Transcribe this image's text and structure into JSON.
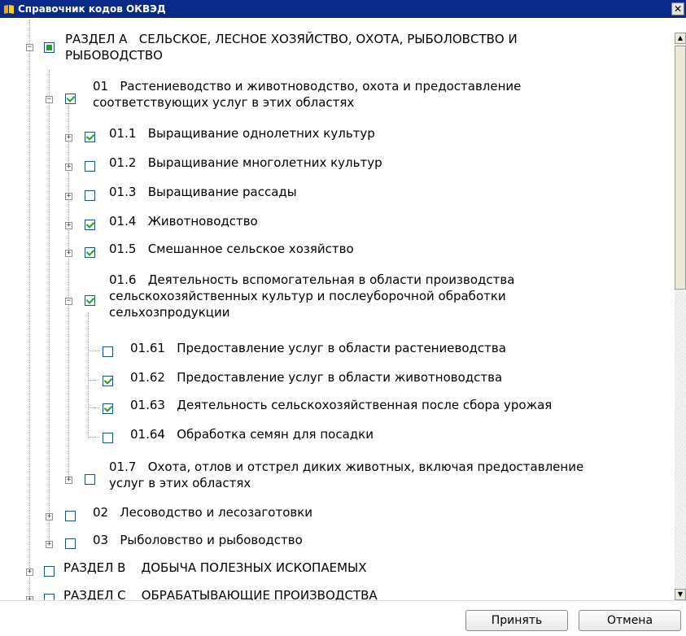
{
  "window": {
    "title": "Справочник кодов ОКВЭД",
    "close_glyph": "✕"
  },
  "tree": {
    "nodes": [
      {
        "code": "РАЗДЕЛ А",
        "text": "СЕЛЬСКОЕ, ЛЕСНОЕ ХОЗЯЙСТВО, ОХОТА, РЫБОЛОВСТВО И РЫБОВОДСТВО",
        "state": "partial",
        "expanded": true
      },
      {
        "code": "01",
        "text": "Растениеводство и животноводство, охота и предоставление соответствующих услуг в этих областях",
        "state": "checked",
        "expanded": true
      },
      {
        "code": "01.1",
        "text": "Выращивание однолетних культур",
        "state": "checked",
        "expanded": false
      },
      {
        "code": "01.2",
        "text": "Выращивание многолетних культур",
        "state": "unchecked",
        "expanded": false
      },
      {
        "code": "01.3",
        "text": "Выращивание рассады",
        "state": "unchecked",
        "expanded": false
      },
      {
        "code": "01.4",
        "text": "Животноводство",
        "state": "checked",
        "expanded": false
      },
      {
        "code": "01.5",
        "text": "Смешанное сельское хозяйство",
        "state": "checked",
        "expanded": false
      },
      {
        "code": "01.6",
        "text": "Деятельность вспомогательная в области производства сельскохозяйственных культур и послеуборочной обработки сельхозпродукции",
        "state": "checked",
        "expanded": true
      },
      {
        "code": "01.61",
        "text": "Предоставление услуг в области растениеводства",
        "state": "unchecked"
      },
      {
        "code": "01.62",
        "text": "Предоставление услуг в области животноводства",
        "state": "checked"
      },
      {
        "code": "01.63",
        "text": "Деятельность сельскохозяйственная после сбора урожая",
        "state": "checked"
      },
      {
        "code": "01.64",
        "text": "Обработка семян для посадки",
        "state": "unchecked"
      },
      {
        "code": "01.7",
        "text": "Охота, отлов и отстрел диких животных, включая предоставление услуг в этих областях",
        "state": "unchecked",
        "expanded": false
      },
      {
        "code": "02",
        "text": "Лесоводство и лесозаготовки",
        "state": "unchecked",
        "expanded": false
      },
      {
        "code": "03",
        "text": "Рыболовство и рыбоводство",
        "state": "unchecked",
        "expanded": false
      },
      {
        "code": "РАЗДЕЛ В",
        "text": "ДОБЫЧА ПОЛЕЗНЫХ ИСКОПАЕМЫХ",
        "state": "unchecked",
        "expanded": false
      },
      {
        "code": "РАЗДЕЛ С",
        "text": "ОБРАБАТЫВАЮЩИЕ ПРОИЗВОДСТВА",
        "state": "unchecked",
        "expanded": false
      }
    ],
    "labels": {
      "n0": "РАЗДЕЛ А   СЕЛЬСКОЕ, ЛЕСНОЕ ХОЗЯЙСТВО, ОХОТА, РЫБОЛОВСТВО И\nРЫБОВОДСТВО",
      "n1": "01   Растениеводство и животноводство, охота и предоставление\nсоответствующих услуг в этих областях",
      "n2": "01.1   Выращивание однолетних культур",
      "n3": "01.2   Выращивание многолетних культур",
      "n4": "01.3   Выращивание рассады",
      "n5": "01.4   Животноводство",
      "n6": "01.5   Смешанное сельское хозяйство",
      "n7": "01.6   Деятельность вспомогательная в области производства\nсельскохозяйственных культур и послеуборочной обработки\nсельхозпродукции",
      "n8": "01.61   Предоставление услуг в области растениеводства",
      "n9": "01.62   Предоставление услуг в области животноводства",
      "n10": "01.63   Деятельность сельскохозяйственная после сбора урожая",
      "n11": "01.64   Обработка семян для посадки",
      "n12": "01.7   Охота, отлов и отстрел диких животных, включая предоставление\nуслуг в этих областях",
      "n13": "02   Лесоводство и лесозаготовки",
      "n14": "03   Рыболовство и рыбоводство",
      "n15": "РАЗДЕЛ В    ДОБЫЧА ПОЛЕЗНЫХ ИСКОПАЕМЫХ",
      "n16": "РАЗДЕЛ С    ОБРАБАТЫВАЮЩИЕ ПРОИЗВОДСТВА"
    }
  },
  "buttons": {
    "accept": "Принять",
    "cancel": "Отмена"
  },
  "colors": {
    "titlebar": "#0a2a8a",
    "check": "#21a121",
    "checkbox_border": "#1c5180"
  },
  "icons": {
    "app": "book-icon",
    "expand": "plus-icon",
    "collapse": "minus-icon"
  }
}
